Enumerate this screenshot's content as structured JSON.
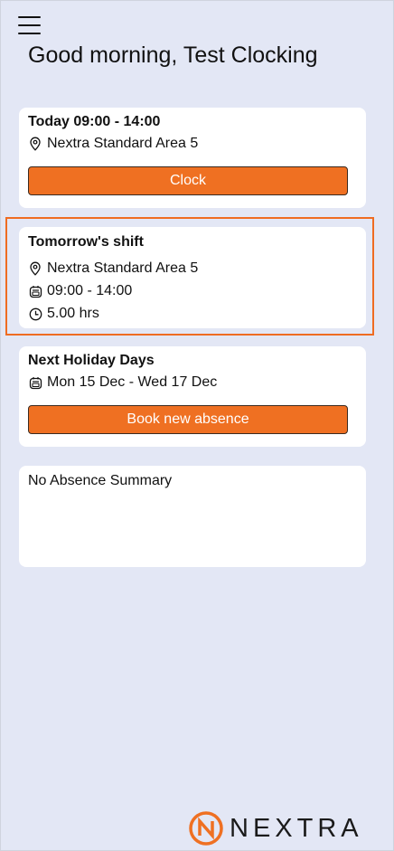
{
  "header": {
    "greeting": "Good morning, Test Clocking"
  },
  "today_card": {
    "title": "Today 09:00 - 14:00",
    "location": "Nextra Standard Area 5",
    "clock_label": "Clock"
  },
  "tomorrow_card": {
    "title": "Tomorrow's shift",
    "location": "Nextra Standard Area 5",
    "time": "09:00 - 14:00",
    "hours": "5.00 hrs"
  },
  "holiday_card": {
    "title": "Next Holiday Days",
    "dates": "Mon 15 Dec - Wed 17 Dec",
    "book_label": "Book new absence"
  },
  "absence_summary": {
    "text": "No Absence Summary"
  },
  "brand": {
    "name": "NEXTRA",
    "accent_color": "#ef7022",
    "background_color": "#e3e7f5"
  }
}
